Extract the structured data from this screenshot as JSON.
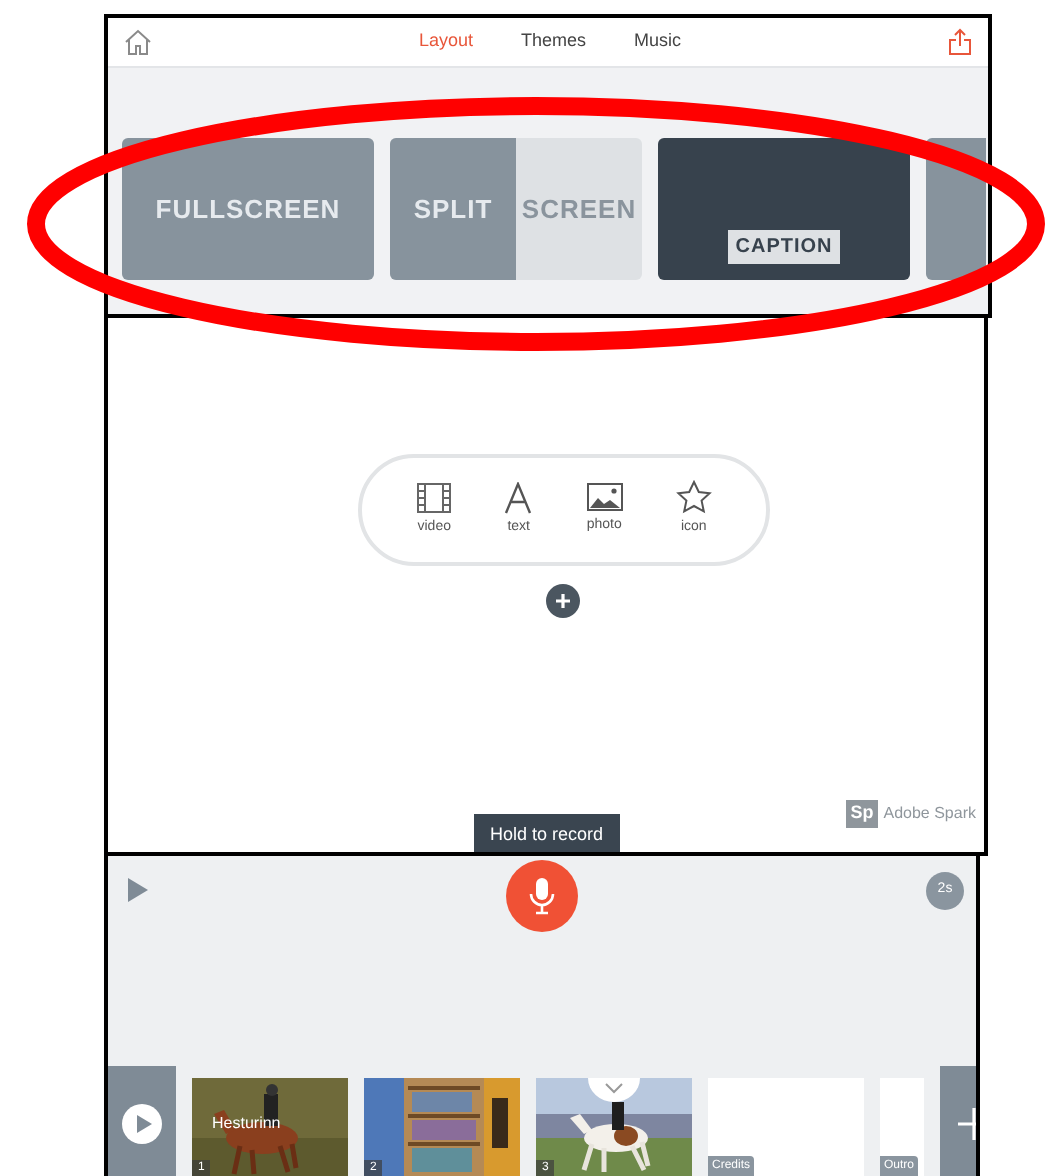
{
  "tabs": [
    {
      "label": "Layout",
      "selected": true
    },
    {
      "label": "Themes",
      "selected": false
    },
    {
      "label": "Music",
      "selected": false
    }
  ],
  "layouts": [
    {
      "kind": "full",
      "labels": [
        "FULLSCREEN"
      ]
    },
    {
      "kind": "split",
      "labels": [
        "SPLIT",
        "SCREEN"
      ]
    },
    {
      "kind": "caption",
      "labels": [
        "CAPTION"
      ]
    },
    {
      "kind": "partial"
    }
  ],
  "add_menu": [
    {
      "kind": "video",
      "label": "video"
    },
    {
      "kind": "text",
      "label": "text"
    },
    {
      "label": "photo"
    },
    {
      "kind": "icon",
      "label": "icon"
    }
  ],
  "tooltip": "Hold to record",
  "branding": {
    "logo": "Sp",
    "name": "Adobe Spark"
  },
  "duration": "2s",
  "slides": [
    {
      "kind": "picture",
      "title": "Hesturinn",
      "number": "1"
    },
    {
      "kind": "picture",
      "number": "2"
    },
    {
      "kind": "picture",
      "number": "3"
    },
    {
      "kind": "blank",
      "tag": "Credits"
    },
    {
      "kind": "partial",
      "tag": "Outro"
    }
  ]
}
